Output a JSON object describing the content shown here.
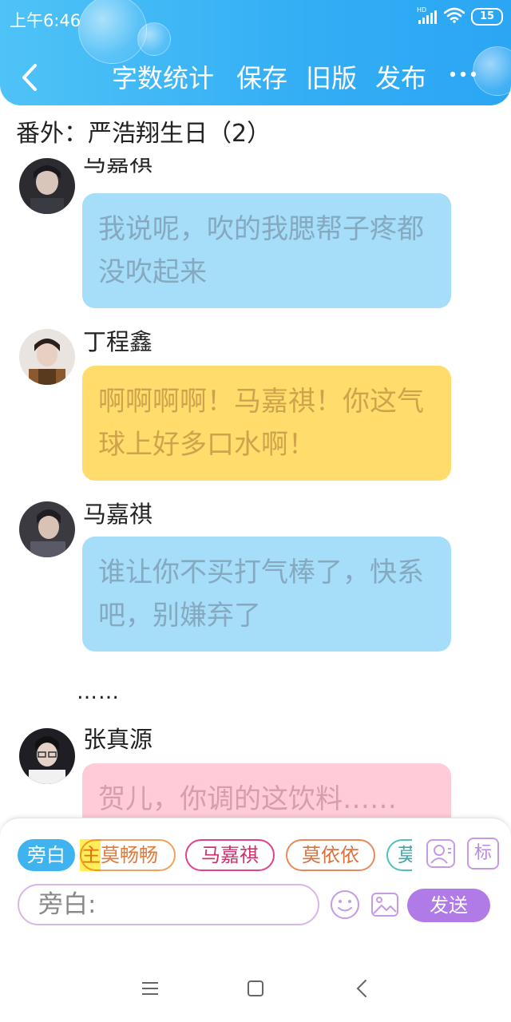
{
  "status_bar": {
    "time": "上午6:46",
    "hd_label": "HD",
    "battery": "15"
  },
  "toolbar": {
    "word_count": "字数统计",
    "save": "保存",
    "old_version": "旧版",
    "publish": "发布"
  },
  "document": {
    "title": "番外：严浩翔生日（2）"
  },
  "messages": [
    {
      "speaker": "马嘉祺",
      "text": "我说呢，吹的我腮帮子疼都没吹起来",
      "color": "#a6ddf9"
    },
    {
      "speaker": "丁程鑫",
      "text": "啊啊啊啊！马嘉祺！你这气球上好多口水啊！",
      "color": "#ffdc6b"
    },
    {
      "speaker": "马嘉祺",
      "text": "谁让你不买打气棒了，快系吧，别嫌弃了",
      "color": "#a6ddf9"
    },
    {
      "speaker": "张真源",
      "text": "贺儿，你调的这饮料……",
      "color": "#ffcbd8"
    }
  ],
  "narration_text": "……",
  "composer": {
    "roles": [
      {
        "label": "旁白",
        "color": "#3eb3f0"
      },
      {
        "label": "主莫畅畅",
        "color": "#f5a05a"
      },
      {
        "label": "马嘉祺",
        "color": "#e0408c"
      },
      {
        "label": "莫依依",
        "color": "#e8895a"
      },
      {
        "label": "莫",
        "color": "#4fc0c0"
      }
    ],
    "input_value": "旁白:",
    "tag_label": "标",
    "send_label": "发送",
    "accent": "#b07be6"
  }
}
